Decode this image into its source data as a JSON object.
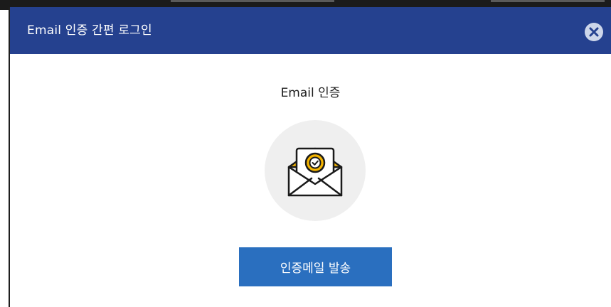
{
  "dialog": {
    "title": "Email 인증 간편 로그인",
    "close_icon": "close-icon"
  },
  "content": {
    "heading": "Email 인증",
    "illustration_icon": "email-verified-icon",
    "send_button_label": "인증메일 발송"
  },
  "colors": {
    "header_bg": "#25418f",
    "button_bg": "#2a6fbf",
    "icon_accent": "#f4b400",
    "circle_bg": "#efefef"
  }
}
